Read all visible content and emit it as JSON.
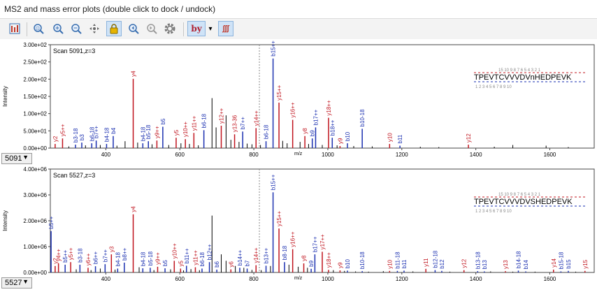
{
  "window": {
    "title": "MS2 and mass error plots (double click to dock / undock)"
  },
  "toolbar": {
    "buttons": [
      {
        "name": "spectrum-list-icon",
        "color": "#c0392b"
      },
      {
        "name": "zoom-fit-icon",
        "color": "#3a6fb0"
      },
      {
        "name": "zoom-in-icon",
        "color": "#3a6fb0"
      },
      {
        "name": "zoom-out-icon",
        "color": "#3a6fb0"
      },
      {
        "name": "pan-icon",
        "color": "#666666"
      },
      {
        "name": "lock-icon",
        "color": "#d9a400"
      },
      {
        "name": "previous-icon",
        "color": "#3a6fb0"
      },
      {
        "name": "next-icon",
        "color": "#3a6fb0"
      },
      {
        "name": "settings-icon",
        "color": "#777777"
      },
      {
        "name": "ion-types-icon",
        "label": "by",
        "color": "#b02030"
      },
      {
        "name": "dropdown-arrow-icon",
        "label": "▾"
      },
      {
        "name": "isotope-icon",
        "label": "∫∫∫",
        "color": "#c0392b"
      }
    ]
  },
  "colors": {
    "b_ion": "#1a2fb0",
    "y_ion": "#c0141e",
    "other": "#2e7d32",
    "peak": "#000000"
  },
  "plots": [
    {
      "scan_label": "Scan 5091,z=3",
      "scan_number": "5091",
      "chart_data": {
        "type": "bar",
        "ylabel": "Intensity",
        "xlabel": "m/z",
        "xlim": [
          250,
          1720
        ],
        "ylim": [
          0,
          300
        ],
        "yticks": [
          "0.00e+00",
          "5.00e+01",
          "1.00e+02",
          "1.50e+02",
          "2.00e+02",
          "2.50e+02",
          "3.00e+02"
        ],
        "xticks": [
          "400",
          "600",
          "800",
          "1000",
          "1200",
          "1400",
          "1600"
        ],
        "precursor_mz": 815,
        "peptide": "TPEVTCVVVDVnHEDPEVK",
        "b_numbers": "1 2 3 4 5 6 7 8 9 10",
        "y_numbers": "15 10 9 8 7 6 5 4 3 2 1",
        "annotated_peaks": [
          {
            "mz": 263,
            "value": 12,
            "label": "y2",
            "ion": "y"
          },
          {
            "mz": 283,
            "value": 28,
            "label": "y5++",
            "ion": "y"
          },
          {
            "mz": 318,
            "value": 10,
            "label": "b3-18",
            "ion": "b"
          },
          {
            "mz": 335,
            "value": 16,
            "label": "b3",
            "ion": "b"
          },
          {
            "mz": 362,
            "value": 14,
            "label": "b6-18",
            "ion": "b"
          },
          {
            "mz": 374,
            "value": 22,
            "label": "b7++",
            "ion": "b"
          },
          {
            "mz": 402,
            "value": 12,
            "label": "b4-18",
            "ion": "b"
          },
          {
            "mz": 420,
            "value": 35,
            "label": "b4",
            "ion": "b"
          },
          {
            "mz": 474,
            "value": 201,
            "label": "y4",
            "ion": "y"
          },
          {
            "mz": 500,
            "value": 14,
            "label": "b4-18",
            "ion": "b"
          },
          {
            "mz": 515,
            "value": 20,
            "label": "b5-18",
            "ion": "b"
          },
          {
            "mz": 538,
            "value": 22,
            "label": "y9++",
            "ion": "y"
          },
          {
            "mz": 554,
            "value": 62,
            "label": "b5",
            "ion": "b"
          },
          {
            "mz": 590,
            "value": 30,
            "label": "y5",
            "ion": "y"
          },
          {
            "mz": 615,
            "value": 26,
            "label": "y10++",
            "ion": "y"
          },
          {
            "mz": 638,
            "value": 44,
            "label": "y11++",
            "ion": "y"
          },
          {
            "mz": 665,
            "value": 52,
            "label": "b6-18",
            "ion": "b"
          },
          {
            "mz": 712,
            "value": 65,
            "label": "y12++",
            "ion": "y"
          },
          {
            "mz": 748,
            "value": 40,
            "label": "y13-36",
            "ion": "y"
          },
          {
            "mz": 770,
            "value": 48,
            "label": "b7++",
            "ion": "b"
          },
          {
            "mz": 806,
            "value": 58,
            "label": "y14++",
            "ion": "y"
          },
          {
            "mz": 833,
            "value": 20,
            "label": "b6-18",
            "ion": "b"
          },
          {
            "mz": 852,
            "value": 260,
            "label": "b15++",
            "ion": "b"
          },
          {
            "mz": 868,
            "value": 132,
            "label": "y15++",
            "ion": "y"
          },
          {
            "mz": 905,
            "value": 82,
            "label": "y16++",
            "ion": "y"
          },
          {
            "mz": 938,
            "value": 35,
            "label": "y8",
            "ion": "y"
          },
          {
            "mz": 958,
            "value": 28,
            "label": "b9",
            "ion": "b"
          },
          {
            "mz": 967,
            "value": 60,
            "label": "b17++",
            "ion": "b"
          },
          {
            "mz": 1002,
            "value": 88,
            "label": "y18++",
            "ion": "y"
          },
          {
            "mz": 1012,
            "value": 30,
            "label": "b18++",
            "ion": "b"
          },
          {
            "mz": 1033,
            "value": 6,
            "label": "y9",
            "ion": "y"
          },
          {
            "mz": 1053,
            "value": 14,
            "label": "b10",
            "ion": "b"
          },
          {
            "mz": 1093,
            "value": 56,
            "label": "b10-18",
            "ion": "b"
          },
          {
            "mz": 1167,
            "value": 12,
            "label": "y10",
            "ion": "y"
          },
          {
            "mz": 1195,
            "value": 7,
            "label": "b11",
            "ion": "b"
          },
          {
            "mz": 1380,
            "value": 10,
            "label": "y12",
            "ion": "y"
          }
        ],
        "minor_peaks": [
          {
            "mz": 300,
            "value": 5
          },
          {
            "mz": 345,
            "value": 8
          },
          {
            "mz": 385,
            "value": 9
          },
          {
            "mz": 430,
            "value": 7
          },
          {
            "mz": 452,
            "value": 20
          },
          {
            "mz": 486,
            "value": 16
          },
          {
            "mz": 525,
            "value": 11
          },
          {
            "mz": 570,
            "value": 9
          },
          {
            "mz": 603,
            "value": 14
          },
          {
            "mz": 626,
            "value": 12
          },
          {
            "mz": 650,
            "value": 8
          },
          {
            "mz": 687,
            "value": 145
          },
          {
            "mz": 698,
            "value": 60
          },
          {
            "mz": 725,
            "value": 95
          },
          {
            "mz": 738,
            "value": 24
          },
          {
            "mz": 760,
            "value": 18
          },
          {
            "mz": 782,
            "value": 13
          },
          {
            "mz": 795,
            "value": 11
          },
          {
            "mz": 818,
            "value": 9
          },
          {
            "mz": 878,
            "value": 21
          },
          {
            "mz": 890,
            "value": 14
          },
          {
            "mz": 925,
            "value": 18
          },
          {
            "mz": 948,
            "value": 12
          },
          {
            "mz": 985,
            "value": 9
          },
          {
            "mz": 1025,
            "value": 8
          },
          {
            "mz": 1070,
            "value": 6
          },
          {
            "mz": 1120,
            "value": 5
          },
          {
            "mz": 1250,
            "value": 4
          },
          {
            "mz": 1300,
            "value": 3
          },
          {
            "mz": 1450,
            "value": 4
          },
          {
            "mz": 1500,
            "value": 9
          },
          {
            "mz": 1590,
            "value": 7
          },
          {
            "mz": 1650,
            "value": 3
          }
        ]
      }
    },
    {
      "scan_label": "Scan 5527,z=3",
      "scan_number": "5527",
      "chart_data": {
        "type": "bar",
        "ylabel": "Intensity",
        "xlabel": "m/z",
        "xlim": [
          250,
          1720
        ],
        "ylim": [
          0,
          4000000
        ],
        "yticks": [
          "0.00e+00",
          "1.00e+06",
          "2.00e+06",
          "3.00e+06",
          "4.00e+06"
        ],
        "xticks": [
          "400",
          "600",
          "800",
          "1000",
          "1200",
          "1400",
          "1600"
        ],
        "precursor_mz": 815,
        "peptide": "TPEVTCVVVDVSHEDPEVK",
        "b_numbers": "1 2 3 4 5 6 7 8 9 10",
        "y_numbers": "15 10 9 8 7 6 5 4 3 2 1",
        "annotated_peaks": [
          {
            "mz": 252,
            "value": 1600000,
            "label": "b5++",
            "ion": "b"
          },
          {
            "mz": 263,
            "value": 250000,
            "label": "y2",
            "ion": "y"
          },
          {
            "mz": 272,
            "value": 350000,
            "label": "y4++",
            "ion": "y"
          },
          {
            "mz": 290,
            "value": 300000,
            "label": "b5++",
            "ion": "b"
          },
          {
            "mz": 305,
            "value": 400000,
            "label": "y5++",
            "ion": "y"
          },
          {
            "mz": 330,
            "value": 300000,
            "label": "b3-18",
            "ion": "b"
          },
          {
            "mz": 352,
            "value": 180000,
            "label": "y6++",
            "ion": "y"
          },
          {
            "mz": 372,
            "value": 240000,
            "label": "b6++",
            "ion": "b"
          },
          {
            "mz": 398,
            "value": 320000,
            "label": "b7++",
            "ion": "b"
          },
          {
            "mz": 415,
            "value": 700000,
            "label": "y3",
            "ion": "y"
          },
          {
            "mz": 432,
            "value": 150000,
            "label": "b4-18",
            "ion": "b"
          },
          {
            "mz": 450,
            "value": 380000,
            "label": "b8++",
            "ion": "b"
          },
          {
            "mz": 474,
            "value": 2250000,
            "label": "y4",
            "ion": "y"
          },
          {
            "mz": 500,
            "value": 160000,
            "label": "b4-18",
            "ion": "b"
          },
          {
            "mz": 520,
            "value": 180000,
            "label": "b5-18",
            "ion": "b"
          },
          {
            "mz": 540,
            "value": 220000,
            "label": "y9++",
            "ion": "y"
          },
          {
            "mz": 560,
            "value": 160000,
            "label": "b5",
            "ion": "b"
          },
          {
            "mz": 585,
            "value": 450000,
            "label": "y10++",
            "ion": "y"
          },
          {
            "mz": 602,
            "value": 150000,
            "label": "y5",
            "ion": "y"
          },
          {
            "mz": 618,
            "value": 260000,
            "label": "b11++",
            "ion": "b"
          },
          {
            "mz": 642,
            "value": 200000,
            "label": "y11++",
            "ion": "y"
          },
          {
            "mz": 660,
            "value": 150000,
            "label": "b6-18",
            "ion": "b"
          },
          {
            "mz": 680,
            "value": 400000,
            "label": "b12++",
            "ion": "b"
          },
          {
            "mz": 700,
            "value": 110000,
            "label": "b6",
            "ion": "b"
          },
          {
            "mz": 738,
            "value": 120000,
            "label": "y6",
            "ion": "y"
          },
          {
            "mz": 762,
            "value": 180000,
            "label": "b14++",
            "ion": "b"
          },
          {
            "mz": 782,
            "value": 150000,
            "label": "b7",
            "ion": "b"
          },
          {
            "mz": 806,
            "value": 280000,
            "label": "y14++",
            "ion": "y"
          },
          {
            "mz": 833,
            "value": 260000,
            "label": "b13++",
            "ion": "b"
          },
          {
            "mz": 852,
            "value": 3100000,
            "label": "b15++",
            "ion": "b"
          },
          {
            "mz": 868,
            "value": 1700000,
            "label": "y15++",
            "ion": "y"
          },
          {
            "mz": 883,
            "value": 400000,
            "label": "b8-18",
            "ion": "b"
          },
          {
            "mz": 905,
            "value": 900000,
            "label": "y16++",
            "ion": "y"
          },
          {
            "mz": 935,
            "value": 350000,
            "label": "y8",
            "ion": "y"
          },
          {
            "mz": 955,
            "value": 140000,
            "label": "b9",
            "ion": "b"
          },
          {
            "mz": 965,
            "value": 700000,
            "label": "b17++",
            "ion": "b"
          },
          {
            "mz": 985,
            "value": 800000,
            "label": "y17++",
            "ion": "y"
          },
          {
            "mz": 1002,
            "value": 100000,
            "label": "y18++",
            "ion": "y"
          },
          {
            "mz": 1033,
            "value": 80000,
            "label": "y9",
            "ion": "y"
          },
          {
            "mz": 1053,
            "value": 70000,
            "label": "b10",
            "ion": "b"
          },
          {
            "mz": 1093,
            "value": 50000,
            "label": "b10-18",
            "ion": "b"
          },
          {
            "mz": 1167,
            "value": 60000,
            "label": "y10",
            "ion": "y"
          },
          {
            "mz": 1188,
            "value": 60000,
            "label": "b11-18",
            "ion": "b"
          },
          {
            "mz": 1206,
            "value": 70000,
            "label": "b11",
            "ion": "b"
          },
          {
            "mz": 1265,
            "value": 140000,
            "label": "y11",
            "ion": "y"
          },
          {
            "mz": 1290,
            "value": 90000,
            "label": "b12-18",
            "ion": "b"
          },
          {
            "mz": 1308,
            "value": 60000,
            "label": "b12",
            "ion": "b"
          },
          {
            "mz": 1368,
            "value": 90000,
            "label": "y12",
            "ion": "y"
          },
          {
            "mz": 1405,
            "value": 50000,
            "label": "b13-18",
            "ion": "b"
          },
          {
            "mz": 1423,
            "value": 40000,
            "label": "b13",
            "ion": "b"
          },
          {
            "mz": 1480,
            "value": 50000,
            "label": "y13",
            "ion": "y"
          },
          {
            "mz": 1515,
            "value": 70000,
            "label": "b14-18",
            "ion": "b"
          },
          {
            "mz": 1535,
            "value": 40000,
            "label": "b14",
            "ion": "b"
          },
          {
            "mz": 1610,
            "value": 110000,
            "label": "y14",
            "ion": "y"
          },
          {
            "mz": 1630,
            "value": 40000,
            "label": "b15-18",
            "ion": "b"
          },
          {
            "mz": 1650,
            "value": 60000,
            "label": "b15",
            "ion": "b"
          },
          {
            "mz": 1695,
            "value": 60000,
            "label": "y15",
            "ion": "y"
          }
        ],
        "minor_peaks": [
          {
            "mz": 320,
            "value": 120000
          },
          {
            "mz": 360,
            "value": 90000
          },
          {
            "mz": 385,
            "value": 150000
          },
          {
            "mz": 425,
            "value": 110000
          },
          {
            "mz": 490,
            "value": 200000
          },
          {
            "mz": 530,
            "value": 90000
          },
          {
            "mz": 575,
            "value": 120000
          },
          {
            "mz": 610,
            "value": 80000
          },
          {
            "mz": 630,
            "value": 130000
          },
          {
            "mz": 653,
            "value": 90000
          },
          {
            "mz": 687,
            "value": 2200000
          },
          {
            "mz": 712,
            "value": 700000
          },
          {
            "mz": 725,
            "value": 450000
          },
          {
            "mz": 750,
            "value": 250000
          },
          {
            "mz": 773,
            "value": 180000
          },
          {
            "mz": 795,
            "value": 100000
          },
          {
            "mz": 820,
            "value": 90000
          },
          {
            "mz": 845,
            "value": 250000
          },
          {
            "mz": 895,
            "value": 300000
          },
          {
            "mz": 920,
            "value": 220000
          },
          {
            "mz": 945,
            "value": 180000
          },
          {
            "mz": 1015,
            "value": 90000
          },
          {
            "mz": 1045,
            "value": 60000
          },
          {
            "mz": 1075,
            "value": 40000
          },
          {
            "mz": 1110,
            "value": 30000
          },
          {
            "mz": 1150,
            "value": 50000
          },
          {
            "mz": 1230,
            "value": 40000
          },
          {
            "mz": 1330,
            "value": 30000
          },
          {
            "mz": 1440,
            "value": 40000
          },
          {
            "mz": 1500,
            "value": 30000
          },
          {
            "mz": 1560,
            "value": 30000
          },
          {
            "mz": 1670,
            "value": 30000
          }
        ]
      }
    }
  ]
}
